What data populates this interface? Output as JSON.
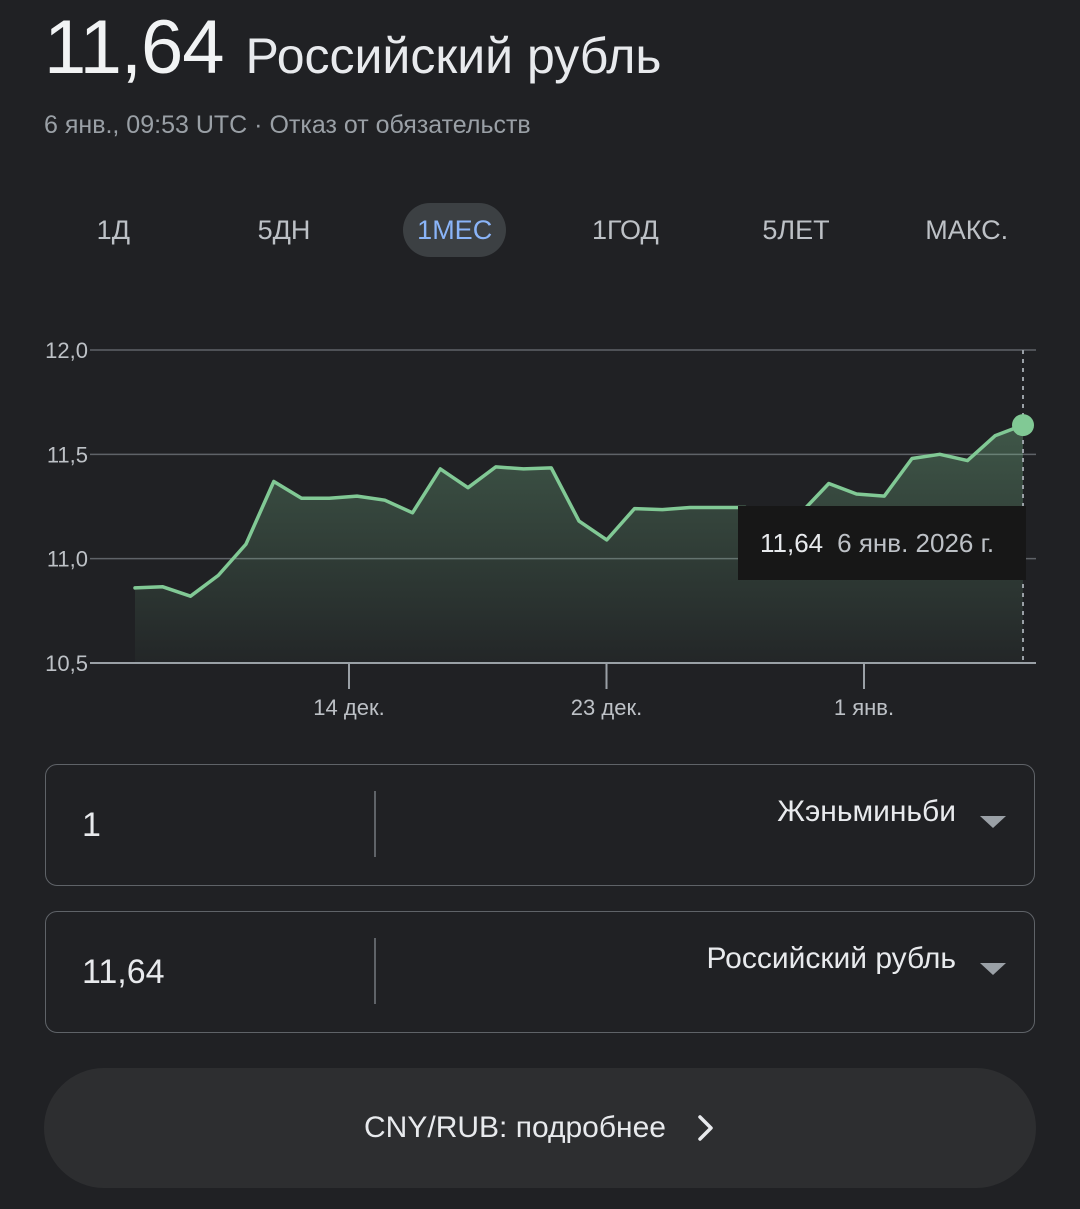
{
  "header": {
    "value": "11,64",
    "currency": "Российский рубль",
    "timestamp": "6 янв., 09:53 UTC",
    "separator": "·",
    "disclaimer": "Отказ от обязательств"
  },
  "tabs": [
    {
      "label": "1Д",
      "active": false
    },
    {
      "label": "5ДН",
      "active": false
    },
    {
      "label": "1МЕС",
      "active": true
    },
    {
      "label": "1ГОД",
      "active": false
    },
    {
      "label": "5ЛЕТ",
      "active": false
    },
    {
      "label": "МАКС.",
      "active": false
    }
  ],
  "tooltip": {
    "value": "11,64",
    "date": "6 янв. 2026 г."
  },
  "colors": {
    "line": "#81c995",
    "accent": "#8ab4f8",
    "background": "#202124"
  },
  "chart_data": {
    "type": "line",
    "ylim": [
      10.5,
      12.0
    ],
    "y_ticks": [
      12.0,
      11.5,
      11.0,
      10.5
    ],
    "y_tick_labels": [
      "12,0",
      "11,5",
      "11,0",
      "10,5"
    ],
    "x_ticks": [
      {
        "label": "14 дек.",
        "index": 8
      },
      {
        "label": "23 дек.",
        "index": 17
      },
      {
        "label": "1 янв.",
        "index": 26
      }
    ],
    "x_count": 32,
    "series": [
      {
        "values": [
          10.86,
          10.865,
          10.82,
          10.92,
          11.07,
          11.37,
          11.29,
          11.29,
          11.3,
          11.28,
          11.22,
          11.43,
          11.34,
          11.44,
          11.43,
          11.435,
          11.18,
          11.09,
          11.24,
          11.235,
          11.245,
          11.245,
          11.245,
          11.15,
          11.22,
          11.36,
          11.31,
          11.3,
          11.48,
          11.5,
          11.47,
          11.59,
          11.64
        ]
      }
    ],
    "grid": true,
    "highlight_last": true
  },
  "converter": {
    "from": {
      "amount": "1",
      "currency": "Жэньминьби"
    },
    "to": {
      "amount": "11,64",
      "currency": "Российский рубль"
    }
  },
  "details_button": {
    "label": "CNY/RUB: подробнее"
  }
}
